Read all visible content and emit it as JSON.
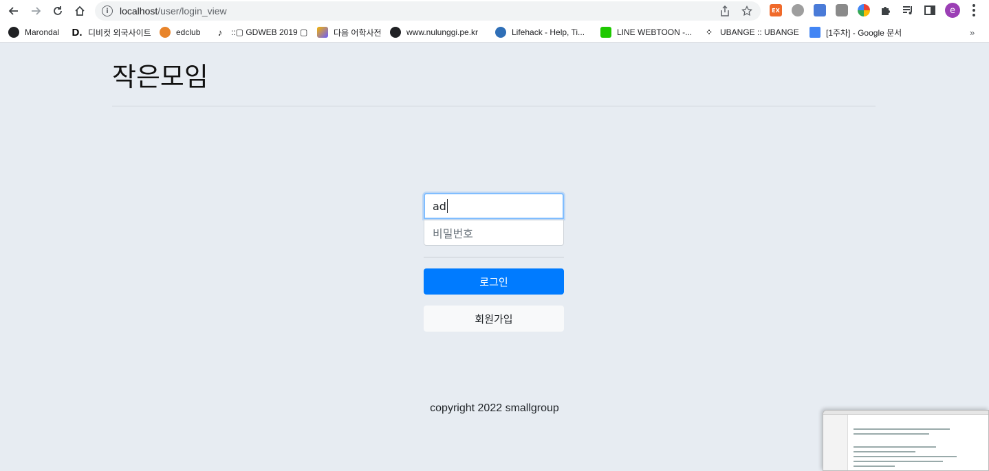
{
  "browser": {
    "url_host": "localhost",
    "url_path": "/user/login_view",
    "profile_initial": "e",
    "bookmarks": [
      {
        "label": "Marondal"
      },
      {
        "label": "디비컷 외국사이트"
      },
      {
        "label": "edclub"
      },
      {
        "label": "::▢ GDWEB 2019 ▢"
      },
      {
        "label": "다음 어학사전"
      },
      {
        "label": "www.nulunggi.pe.kr"
      },
      {
        "label": "Lifehack - Help, Ti..."
      },
      {
        "label": "LINE WEBTOON -..."
      },
      {
        "label": "UBANGE :: UBANGE"
      },
      {
        "label": "[1주차] - Google 문서"
      }
    ],
    "more_bookmarks": "»"
  },
  "page": {
    "brand": "작은모임",
    "login": {
      "id_value": "ad",
      "password_placeholder": "비밀번호",
      "login_button": "로그인",
      "signup_button": "회원가입"
    },
    "footer": "copyright 2022 smallgroup"
  },
  "colors": {
    "background": "#e7ecf2",
    "primary": "#007bff"
  }
}
